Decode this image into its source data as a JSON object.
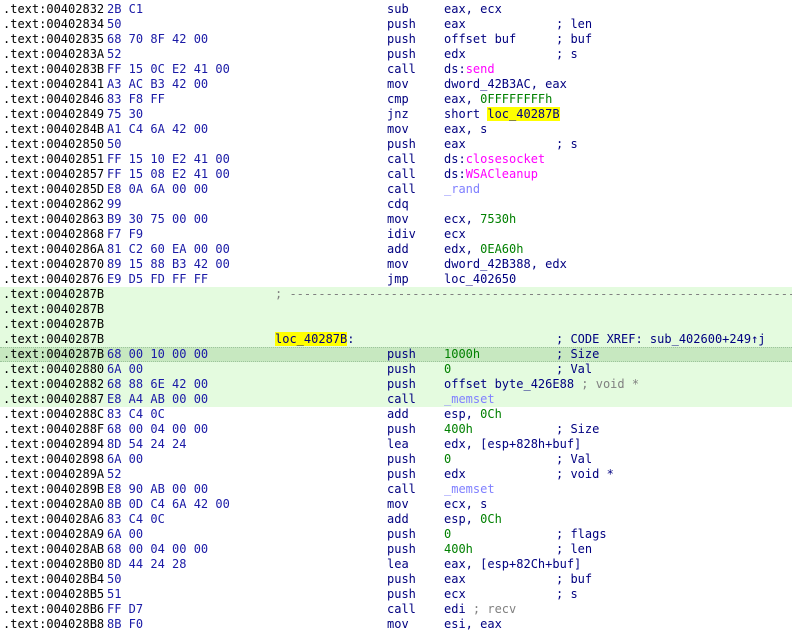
{
  "rows": [
    {
      "addr": ".text:00402832",
      "bytes": "2B C1",
      "mnemonic": "sub",
      "operands": [
        {
          "t": "eax, ecx"
        }
      ],
      "comment": ""
    },
    {
      "addr": ".text:00402834",
      "bytes": "50",
      "mnemonic": "push",
      "operands": [
        {
          "t": "eax"
        }
      ],
      "comment": "; len"
    },
    {
      "addr": ".text:00402835",
      "bytes": "68 70 8F 42 00",
      "mnemonic": "push",
      "operands": [
        {
          "t": "offset buf"
        }
      ],
      "comment": "; buf"
    },
    {
      "addr": ".text:0040283A",
      "bytes": "52",
      "mnemonic": "push",
      "operands": [
        {
          "t": "edx"
        }
      ],
      "comment": "; s"
    },
    {
      "addr": ".text:0040283B",
      "bytes": "FF 15 0C E2 41 00",
      "mnemonic": "call",
      "operands": [
        {
          "t": "ds:"
        },
        {
          "t": "send",
          "k": "imp"
        }
      ],
      "comment": ""
    },
    {
      "addr": ".text:00402841",
      "bytes": "A3 AC B3 42 00",
      "mnemonic": "mov",
      "operands": [
        {
          "t": "dword_42B3AC, eax"
        }
      ],
      "comment": ""
    },
    {
      "addr": ".text:00402846",
      "bytes": "83 F8 FF",
      "mnemonic": "cmp",
      "operands": [
        {
          "t": "eax, "
        },
        {
          "t": "0FFFFFFFFh",
          "k": "num"
        }
      ],
      "comment": ""
    },
    {
      "addr": ".text:00402849",
      "bytes": "75 30",
      "mnemonic": "jnz",
      "operands": [
        {
          "t": "short "
        },
        {
          "t": "loc_40287B",
          "k": "label"
        }
      ],
      "comment": ""
    },
    {
      "addr": ".text:0040284B",
      "bytes": "A1 C4 6A 42 00",
      "mnemonic": "mov",
      "operands": [
        {
          "t": "eax, s"
        }
      ],
      "comment": ""
    },
    {
      "addr": ".text:00402850",
      "bytes": "50",
      "mnemonic": "push",
      "operands": [
        {
          "t": "eax"
        }
      ],
      "comment": "; s"
    },
    {
      "addr": ".text:00402851",
      "bytes": "FF 15 10 E2 41 00",
      "mnemonic": "call",
      "operands": [
        {
          "t": "ds:"
        },
        {
          "t": "closesocket",
          "k": "imp"
        }
      ],
      "comment": ""
    },
    {
      "addr": ".text:00402857",
      "bytes": "FF 15 08 E2 41 00",
      "mnemonic": "call",
      "operands": [
        {
          "t": "ds:"
        },
        {
          "t": "WSACleanup",
          "k": "imp"
        }
      ],
      "comment": ""
    },
    {
      "addr": ".text:0040285D",
      "bytes": "E8 0A 6A 00 00",
      "mnemonic": "call",
      "operands": [
        {
          "t": "_rand",
          "k": "func"
        }
      ],
      "comment": ""
    },
    {
      "addr": ".text:00402862",
      "bytes": "99",
      "mnemonic": "cdq",
      "operands": [],
      "comment": ""
    },
    {
      "addr": ".text:00402863",
      "bytes": "B9 30 75 00 00",
      "mnemonic": "mov",
      "operands": [
        {
          "t": "ecx, "
        },
        {
          "t": "7530h",
          "k": "num"
        }
      ],
      "comment": ""
    },
    {
      "addr": ".text:00402868",
      "bytes": "F7 F9",
      "mnemonic": "idiv",
      "operands": [
        {
          "t": "ecx"
        }
      ],
      "comment": ""
    },
    {
      "addr": ".text:0040286A",
      "bytes": "81 C2 60 EA 00 00",
      "mnemonic": "add",
      "operands": [
        {
          "t": "edx, "
        },
        {
          "t": "0EA60h",
          "k": "num"
        }
      ],
      "comment": ""
    },
    {
      "addr": ".text:00402870",
      "bytes": "89 15 88 B3 42 00",
      "mnemonic": "mov",
      "operands": [
        {
          "t": "dword_42B388, edx"
        }
      ],
      "comment": ""
    },
    {
      "addr": ".text:00402876",
      "bytes": "E9 D5 FD FF FF",
      "mnemonic": "jmp",
      "operands": [
        {
          "t": "loc_402650"
        }
      ],
      "comment": ""
    },
    {
      "addr": ".text:0040287B",
      "sep": "; ---------------------------------------------------------------------------",
      "hl": true
    },
    {
      "addr": ".text:0040287B",
      "hl": true
    },
    {
      "addr": ".text:0040287B",
      "hl": true
    },
    {
      "addr": ".text:0040287B",
      "label": "loc_40287B",
      "label_suffix": ":",
      "comment": "; CODE XREF: sub_402600+249↑j",
      "hl": true
    },
    {
      "addr": ".text:0040287B",
      "bytes": "68 00 10 00 00",
      "mnemonic": "push",
      "operands": [
        {
          "t": "1000h",
          "k": "num"
        }
      ],
      "comment": "; Size",
      "hl": true,
      "cur": true
    },
    {
      "addr": ".text:00402880",
      "bytes": "6A 00",
      "mnemonic": "push",
      "operands": [
        {
          "t": "0",
          "k": "num"
        }
      ],
      "comment": "; Val",
      "hl": true
    },
    {
      "addr": ".text:00402882",
      "bytes": "68 88 6E 42 00",
      "mnemonic": "push",
      "operands": [
        {
          "t": "offset byte_426E88 "
        },
        {
          "t": "; void *",
          "k": "cmt"
        }
      ],
      "comment": "",
      "hl": true
    },
    {
      "addr": ".text:00402887",
      "bytes": "E8 A4 AB 00 00",
      "mnemonic": "call",
      "operands": [
        {
          "t": "_memset",
          "k": "func"
        }
      ],
      "comment": "",
      "hl": true
    },
    {
      "addr": ".text:0040288C",
      "bytes": "83 C4 0C",
      "mnemonic": "add",
      "operands": [
        {
          "t": "esp, "
        },
        {
          "t": "0Ch",
          "k": "num"
        }
      ],
      "comment": ""
    },
    {
      "addr": ".text:0040288F",
      "bytes": "68 00 04 00 00",
      "mnemonic": "push",
      "operands": [
        {
          "t": "400h",
          "k": "num"
        }
      ],
      "comment": "; Size"
    },
    {
      "addr": ".text:00402894",
      "bytes": "8D 54 24 24",
      "mnemonic": "lea",
      "operands": [
        {
          "t": "edx, [esp+828h+buf]"
        }
      ],
      "comment": ""
    },
    {
      "addr": ".text:00402898",
      "bytes": "6A 00",
      "mnemonic": "push",
      "operands": [
        {
          "t": "0",
          "k": "num"
        }
      ],
      "comment": "; Val"
    },
    {
      "addr": ".text:0040289A",
      "bytes": "52",
      "mnemonic": "push",
      "operands": [
        {
          "t": "edx"
        }
      ],
      "comment": "; void *"
    },
    {
      "addr": ".text:0040289B",
      "bytes": "E8 90 AB 00 00",
      "mnemonic": "call",
      "operands": [
        {
          "t": "_memset",
          "k": "func"
        }
      ],
      "comment": ""
    },
    {
      "addr": ".text:004028A0",
      "bytes": "8B 0D C4 6A 42 00",
      "mnemonic": "mov",
      "operands": [
        {
          "t": "ecx, s"
        }
      ],
      "comment": ""
    },
    {
      "addr": ".text:004028A6",
      "bytes": "83 C4 0C",
      "mnemonic": "add",
      "operands": [
        {
          "t": "esp, "
        },
        {
          "t": "0Ch",
          "k": "num"
        }
      ],
      "comment": ""
    },
    {
      "addr": ".text:004028A9",
      "bytes": "6A 00",
      "mnemonic": "push",
      "operands": [
        {
          "t": "0",
          "k": "num"
        }
      ],
      "comment": "; flags"
    },
    {
      "addr": ".text:004028AB",
      "bytes": "68 00 04 00 00",
      "mnemonic": "push",
      "operands": [
        {
          "t": "400h",
          "k": "num"
        }
      ],
      "comment": "; len"
    },
    {
      "addr": ".text:004028B0",
      "bytes": "8D 44 24 28",
      "mnemonic": "lea",
      "operands": [
        {
          "t": "eax, [esp+82Ch+buf]"
        }
      ],
      "comment": ""
    },
    {
      "addr": ".text:004028B4",
      "bytes": "50",
      "mnemonic": "push",
      "operands": [
        {
          "t": "eax"
        }
      ],
      "comment": "; buf"
    },
    {
      "addr": ".text:004028B5",
      "bytes": "51",
      "mnemonic": "push",
      "operands": [
        {
          "t": "ecx"
        }
      ],
      "comment": "; s"
    },
    {
      "addr": ".text:004028B6",
      "bytes": "FF D7",
      "mnemonic": "call",
      "operands": [
        {
          "t": "edi "
        },
        {
          "t": "; recv",
          "k": "cmt"
        }
      ],
      "comment": ""
    },
    {
      "addr": ".text:004028B8",
      "bytes": "8B F0",
      "mnemonic": "mov",
      "operands": [
        {
          "t": "esi, eax"
        }
      ],
      "comment": ""
    }
  ],
  "colors": {
    "import": "#ff00ff",
    "number": "#008000",
    "function": "#8080ff",
    "highlight_bg": "#e4fbdf",
    "current_line_bg": "#c7e8c0",
    "label_highlight": "#ffff00",
    "flow_bar": "#1e3bff"
  }
}
